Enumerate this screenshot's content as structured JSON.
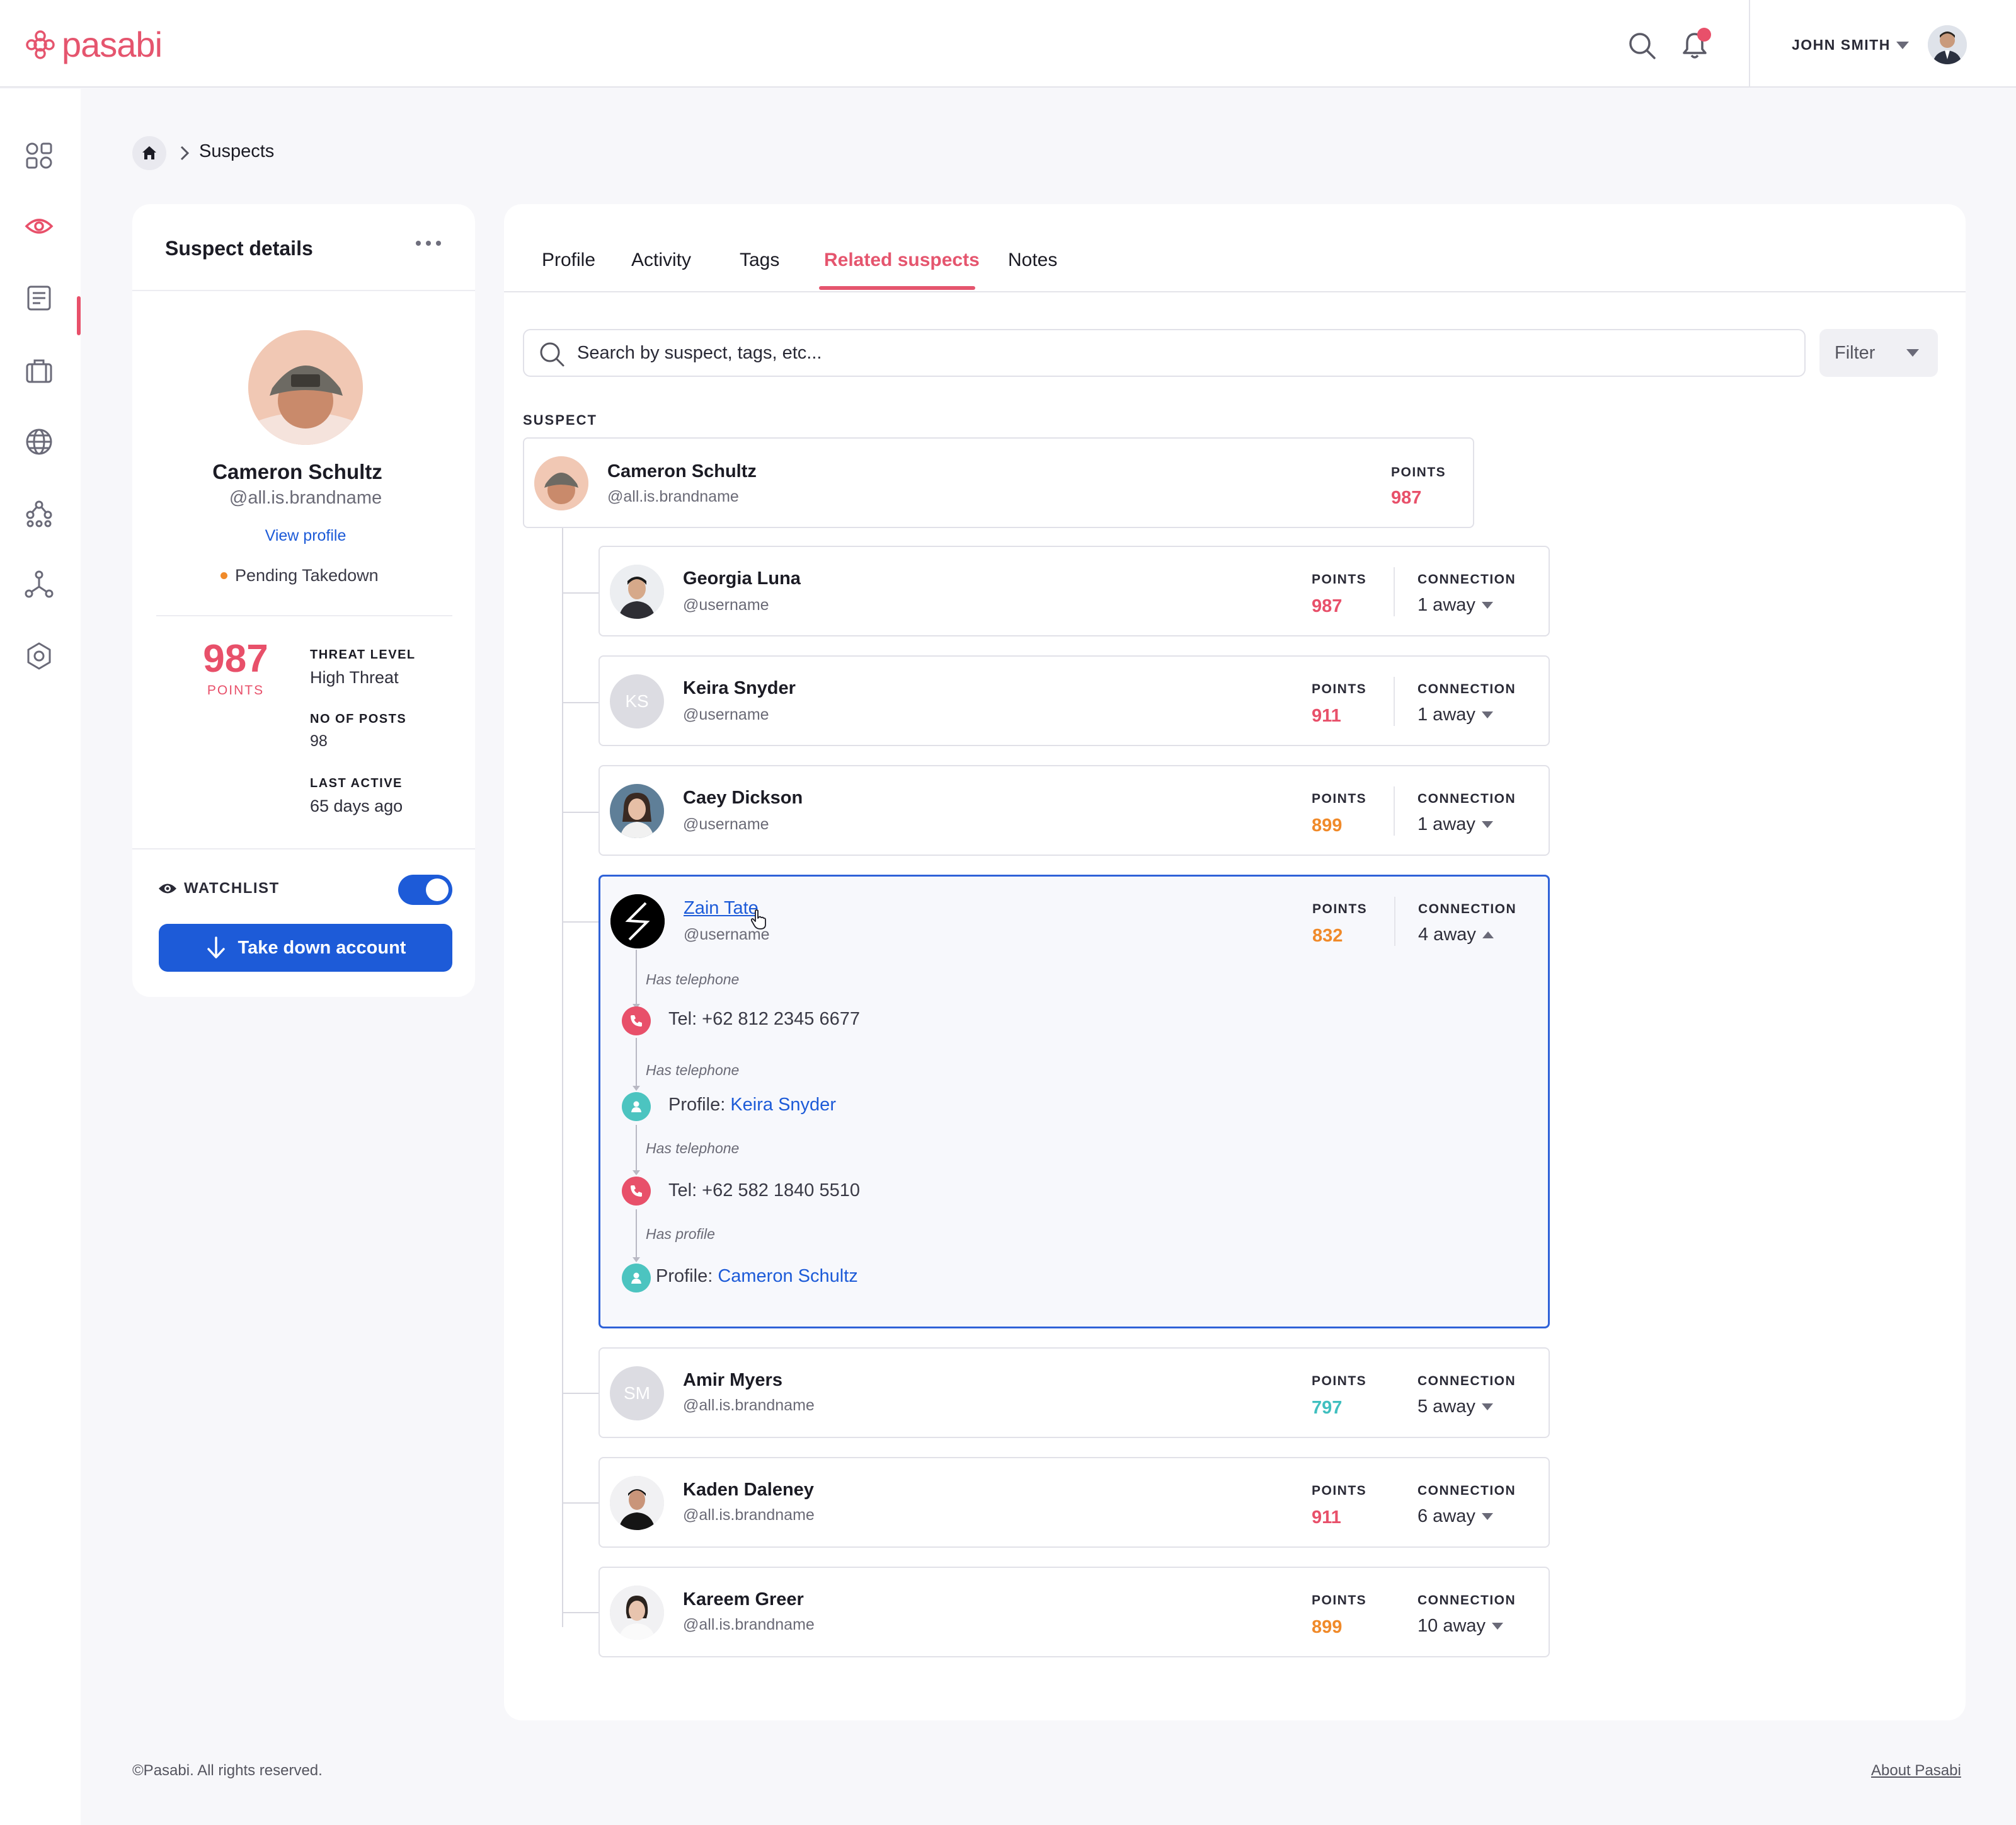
{
  "brand": {
    "name": "pasabi",
    "color": "#e5556e"
  },
  "header": {
    "user_name": "JOHN SMITH",
    "icons": [
      "search-icon",
      "bell-icon"
    ]
  },
  "sidebar": {
    "items": [
      {
        "icon": "dashboard-icon"
      },
      {
        "icon": "eye-icon",
        "active": true
      },
      {
        "icon": "document-icon"
      },
      {
        "icon": "briefcase-icon"
      },
      {
        "icon": "globe-icon"
      },
      {
        "icon": "network-icon"
      },
      {
        "icon": "hierarchy-icon"
      },
      {
        "icon": "settings-icon"
      }
    ]
  },
  "breadcrumb": {
    "current": "Suspects"
  },
  "suspect_details": {
    "title": "Suspect details",
    "name": "Cameron Schultz",
    "handle": "@all.is.brandname",
    "view_profile": "View profile",
    "status": "Pending Takedown",
    "points": "987",
    "points_label": "POINTS",
    "threat_level_label": "THREAT LEVEL",
    "threat_level": "High Threat",
    "posts_label": "NO OF POSTS",
    "posts": "98",
    "last_active_label": "LAST ACTIVE",
    "last_active": "65 days ago",
    "watchlist_label": "WATCHLIST",
    "watchlist_on": true,
    "take_down_label": "Take down account"
  },
  "tabs": [
    {
      "label": "Profile"
    },
    {
      "label": "Activity"
    },
    {
      "label": "Tags"
    },
    {
      "label": "Related suspects",
      "active": true
    },
    {
      "label": "Notes"
    }
  ],
  "search": {
    "placeholder": "Search by suspect, tags, etc...",
    "filter_label": "Filter"
  },
  "suspect_section_label": "SUSPECT",
  "main_suspect": {
    "name": "Cameron Schultz",
    "handle": "@all.is.brandname",
    "points_label": "POINTS",
    "points": "987"
  },
  "labels": {
    "points": "POINTS",
    "connection": "CONNECTION"
  },
  "related": [
    {
      "name": "Georgia Luna",
      "handle": "@username",
      "points": "987",
      "points_color": "#e8506a",
      "connection": "1 away"
    },
    {
      "name": "Keira Snyder",
      "handle": "@username",
      "initials": "KS",
      "points": "911",
      "points_color": "#e8506a",
      "connection": "1 away"
    },
    {
      "name": "Caey Dickson",
      "handle": "@username",
      "points": "899",
      "points_color": "#f08a2a",
      "connection": "1 away"
    },
    {
      "name": "Zain Tate",
      "handle": "@username",
      "points": "832",
      "points_color": "#f08a2a",
      "connection": "4 away",
      "expanded": true
    },
    {
      "name": "Amir Myers",
      "handle": "@all.is.brandname",
      "initials": "SM",
      "points": "797",
      "points_color": "#3fbfbf",
      "connection": "5 away"
    },
    {
      "name": "Kaden Daleney",
      "handle": "@all.is.brandname",
      "points": "911",
      "points_color": "#e8506a",
      "connection": "6 away"
    },
    {
      "name": "Kareem Greer",
      "handle": "@all.is.brandname",
      "points": "899",
      "points_color": "#f08a2a",
      "connection": "10 away"
    }
  ],
  "chain": {
    "rel1": "Has telephone",
    "tel1": "Tel: +62 812  2345 6677",
    "rel2": "Has telephone",
    "profile1_prefix": "Profile: ",
    "profile1_name": "Keira Snyder",
    "rel3": "Has telephone",
    "tel2": "Tel: +62 582  1840 5510",
    "rel4": "Has profile",
    "profile2_prefix": "Profile: ",
    "profile2_name": "Cameron Schultz"
  },
  "footer": {
    "copyright": "©Pasabi. All rights reserved.",
    "about": "About Pasabi"
  }
}
